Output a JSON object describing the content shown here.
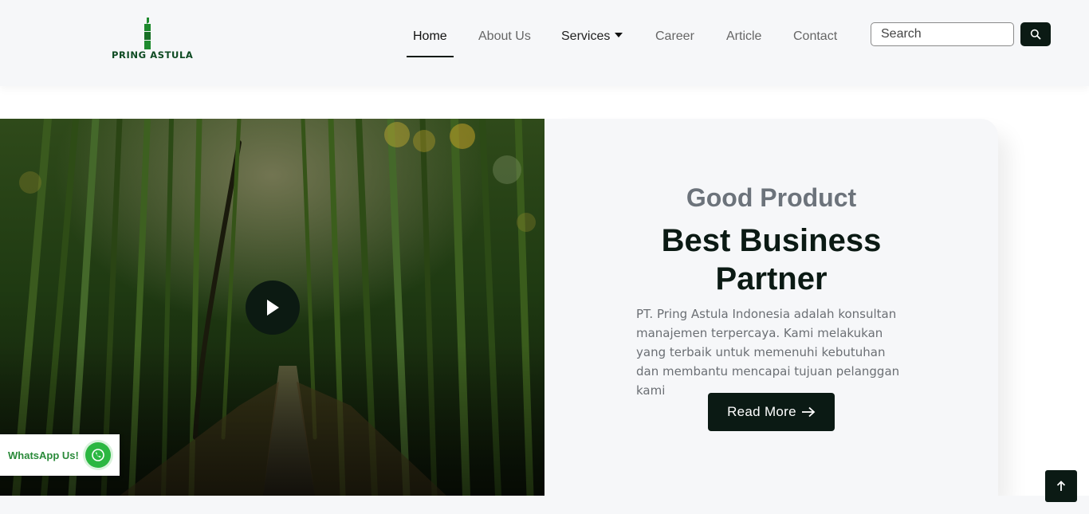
{
  "brand": {
    "name": "PRING ASTULA",
    "accent": "#0b1a14",
    "logo_green": "#1e8a2e"
  },
  "nav": {
    "items": [
      {
        "label": "Home",
        "active": true
      },
      {
        "label": "About Us"
      },
      {
        "label": "Services",
        "has_dropdown": true
      },
      {
        "label": "Career"
      },
      {
        "label": "Article"
      },
      {
        "label": "Contact"
      }
    ],
    "search": {
      "placeholder": "Search",
      "icon": "search-icon"
    }
  },
  "hero": {
    "subtitle": "Good Product",
    "title": "Best Business Partner",
    "description": "PT. Pring Astula Indonesia adalah konsultan manajemen terpercaya. Kami melakukan yang terbaik untuk memenuhi kebutuhan dan membantu mencapai tujuan pelanggan kami",
    "button_label": "Read More",
    "button_icon": "arrow-right-icon",
    "video_icon": "play-icon"
  },
  "whatsapp": {
    "label": "WhatsApp Us!",
    "icon": "whatsapp-icon",
    "color": "#2bb741"
  },
  "back_to_top": {
    "icon": "arrow-up-icon"
  }
}
